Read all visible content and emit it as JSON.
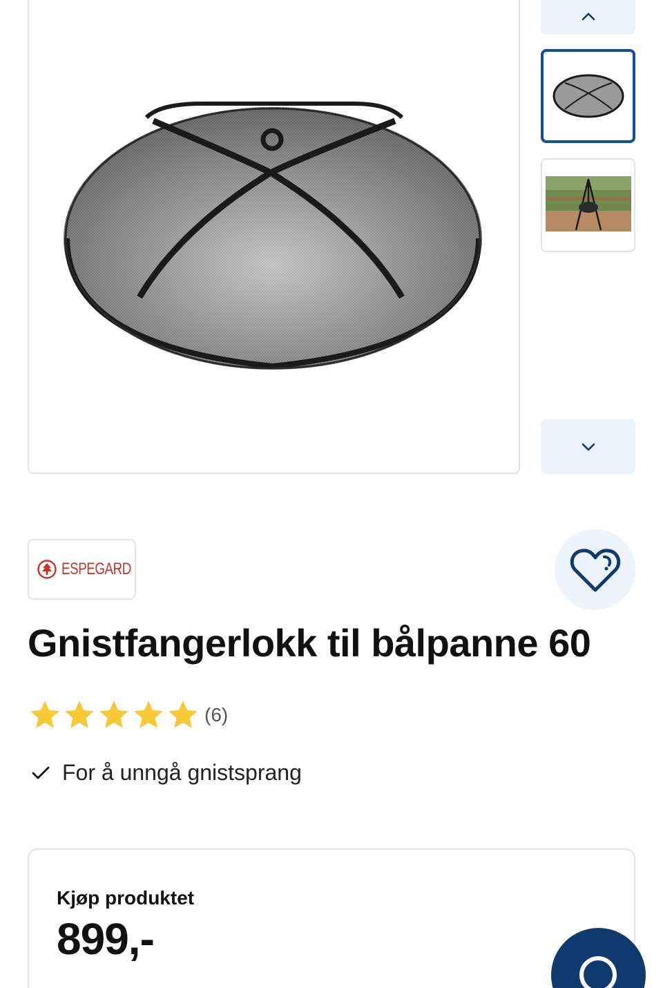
{
  "gallery": {
    "main_image_alt": "Gnistfangerlokk",
    "thumbnails": [
      "spark-screen-thumbnail",
      "outdoor-photo-thumbnail"
    ],
    "selected_thumbnail": 0
  },
  "brand": {
    "name": "ESPEGARD",
    "color": "#c8322c"
  },
  "product": {
    "title": "Gnistfangerlokk til bålpanne 60",
    "rating": 5,
    "rating_max": 5,
    "review_count": "(6)",
    "features": [
      "For å unngå gnistsprang"
    ]
  },
  "purchase": {
    "label": "Kjøp produktet",
    "price": "899,-"
  },
  "colors": {
    "accent": "#0f4ea0",
    "nav_bg": "#eaf2fc",
    "star": "#f7c934",
    "chat_bg": "#0e3a6e"
  },
  "icons": {
    "up": "chevron-up-icon",
    "down": "chevron-down-icon",
    "favorite": "heart-icon",
    "check": "check-icon",
    "chat": "chat-icon"
  }
}
